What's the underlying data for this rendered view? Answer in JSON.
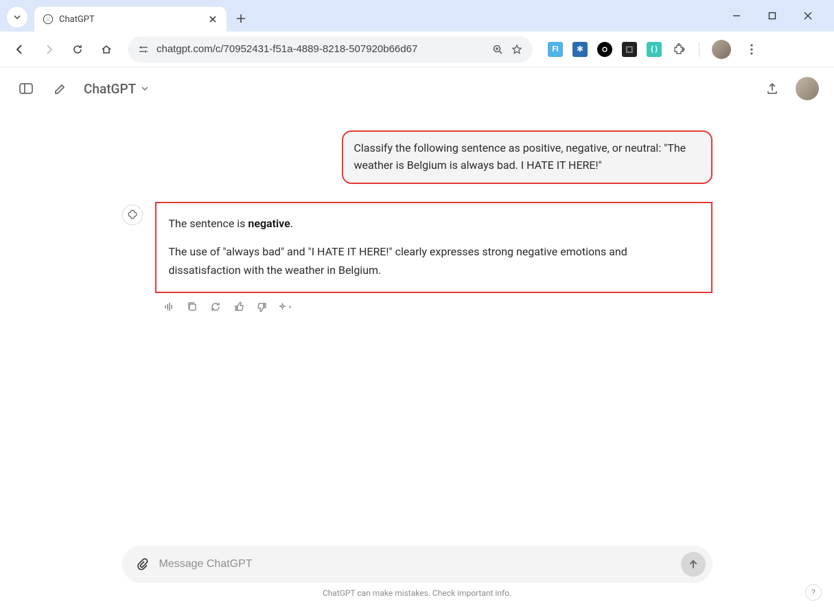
{
  "browser": {
    "tab_title": "ChatGPT",
    "url": "chatgpt.com/c/70952431-f51a-4889-8218-507920b66d67"
  },
  "app": {
    "model_label": "ChatGPT"
  },
  "conversation": {
    "user_message": "Classify the following sentence as positive, negative, or neutral: \"The weather is Belgium is always bad. I HATE IT HERE!\"",
    "assistant_line1_pre": "The sentence is ",
    "assistant_line1_bold": "negative",
    "assistant_line1_post": ".",
    "assistant_line2": "The use of \"always bad\" and \"I HATE IT HERE!\" clearly expresses strong negative emotions and dissatisfaction with the weather in Belgium."
  },
  "composer": {
    "placeholder": "Message ChatGPT"
  },
  "footer": "ChatGPT can make mistakes. Check important info.",
  "help": "?"
}
